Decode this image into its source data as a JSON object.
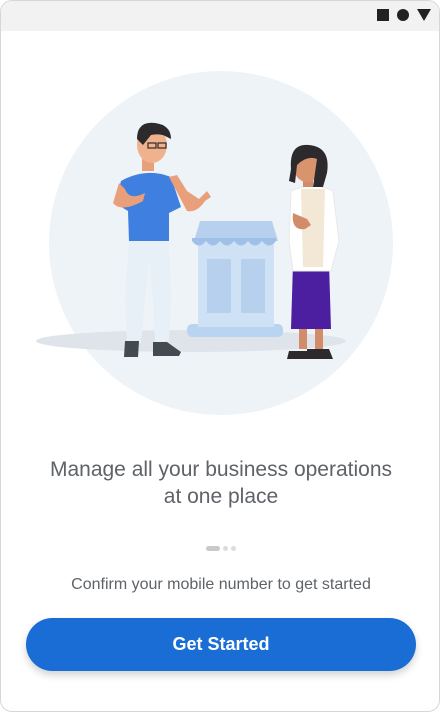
{
  "status_bar": {
    "icons": [
      "square-icon",
      "circle-icon",
      "triangle-icon"
    ]
  },
  "onboarding": {
    "headline_line1": "Manage all your business operations",
    "headline_line2": "at one place",
    "pager": {
      "total": 3,
      "active_index": 0
    },
    "subtext": "Confirm your mobile number to get started",
    "cta_label": "Get Started"
  },
  "colors": {
    "primary": "#1a6dd4",
    "text_secondary": "#5f6368",
    "illustration_bg": "#eef3f8",
    "shirt_blue": "#3f7fe0",
    "skirt_purple": "#4b1fa0"
  }
}
